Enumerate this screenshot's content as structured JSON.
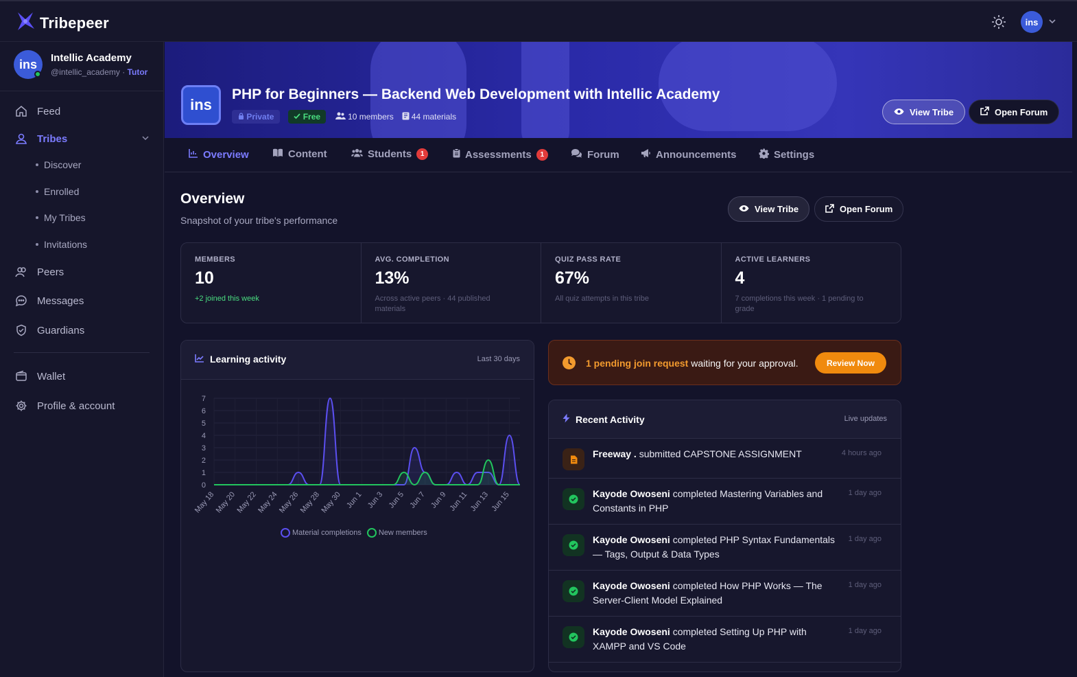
{
  "brand": {
    "name": "Tribepeer"
  },
  "profile": {
    "initials": "ins",
    "name": "Intellic Academy",
    "handle": "@intellic_academy",
    "separator": " · ",
    "role": "Tutor"
  },
  "nav": {
    "feed": "Feed",
    "tribes": "Tribes",
    "tribes_sub": [
      "Discover",
      "Enrolled",
      "My Tribes",
      "Invitations"
    ],
    "peers": "Peers",
    "messages": "Messages",
    "guardians": "Guardians",
    "wallet": "Wallet",
    "profile": "Profile & account"
  },
  "banner": {
    "logo_text": "ins",
    "title": "PHP for Beginners — Backend Web Development with Intellic Academy",
    "private": "Private",
    "free": "Free",
    "members": "10 members",
    "materials": "44 materials",
    "view_tribe": "View Tribe",
    "open_forum": "Open Forum"
  },
  "tabs": [
    {
      "label": "Overview"
    },
    {
      "label": "Content"
    },
    {
      "label": "Students",
      "badge": "1"
    },
    {
      "label": "Assessments",
      "badge": "1"
    },
    {
      "label": "Forum"
    },
    {
      "label": "Announcements"
    },
    {
      "label": "Settings"
    }
  ],
  "overview": {
    "title": "Overview",
    "subtitle": "Snapshot of your tribe's performance",
    "view_tribe": "View Tribe",
    "open_forum": "Open Forum"
  },
  "stats": [
    {
      "label": "MEMBERS",
      "value": "10",
      "note": "+2 joined this week"
    },
    {
      "label": "AVG. COMPLETION",
      "value": "13%",
      "note": "Across active peers · 44 published materials"
    },
    {
      "label": "QUIZ PASS RATE",
      "value": "67%",
      "note": "All quiz attempts in this tribe"
    },
    {
      "label": "ACTIVE LEARNERS",
      "value": "4",
      "note": "7 completions this week · 1 pending to grade"
    }
  ],
  "chart_card": {
    "title": "Learning activity",
    "range": "Last 30 days"
  },
  "chart_data": {
    "type": "area",
    "x": [
      "May 18",
      "May 19",
      "May 20",
      "May 21",
      "May 22",
      "May 23",
      "May 24",
      "May 25",
      "May 26",
      "May 27",
      "May 28",
      "May 29",
      "May 30",
      "May 31",
      "Jun 1",
      "Jun 2",
      "Jun 3",
      "Jun 4",
      "Jun 5",
      "Jun 6",
      "Jun 7",
      "Jun 8",
      "Jun 9",
      "Jun 10",
      "Jun 11",
      "Jun 12",
      "Jun 13",
      "Jun 14",
      "Jun 15",
      "Jun 16"
    ],
    "tick_labels": [
      "May 18",
      "May 20",
      "May 22",
      "May 24",
      "May 26",
      "May 28",
      "May 30",
      "Jun 1",
      "Jun 3",
      "Jun 5",
      "Jun 7",
      "Jun 9",
      "Jun 11",
      "Jun 13",
      "Jun 15"
    ],
    "series": [
      {
        "name": "Material completions",
        "color": "#5b4ff0",
        "values": [
          0,
          0,
          0,
          0,
          0,
          0,
          0,
          0,
          1,
          0,
          0,
          7,
          0,
          0,
          0,
          0,
          0,
          0,
          0,
          3,
          1,
          0,
          0,
          1,
          0,
          1,
          1,
          0,
          4,
          0
        ]
      },
      {
        "name": "New members",
        "color": "#22c55e",
        "values": [
          0,
          0,
          0,
          0,
          0,
          0,
          0,
          0,
          0,
          0,
          0,
          0,
          0,
          0,
          0,
          0,
          0,
          0,
          1,
          0,
          1,
          0,
          0,
          0,
          0,
          0,
          2,
          0,
          0,
          0
        ]
      }
    ],
    "ylim": [
      0,
      7
    ],
    "yticks": [
      0,
      1,
      2,
      3,
      4,
      5,
      6,
      7
    ],
    "grid": true,
    "legend": "bottom"
  },
  "pending": {
    "highlight": "1 pending join request",
    "rest": " waiting for your approval.",
    "button": "Review Now"
  },
  "activity": {
    "title": "Recent Activity",
    "live": "Live updates",
    "items": [
      {
        "icon": "doc",
        "actor": "Freeway .",
        "text": " submitted CAPSTONE ASSIGNMENT",
        "time": "4 hours ago"
      },
      {
        "icon": "check",
        "actor": "Kayode Owoseni",
        "text": " completed Mastering Variables and Constants in PHP",
        "time": "1 day ago"
      },
      {
        "icon": "check",
        "actor": "Kayode Owoseni",
        "text": " completed PHP Syntax Fundamentals — Tags, Output & Data Types",
        "time": "1 day ago"
      },
      {
        "icon": "check",
        "actor": "Kayode Owoseni",
        "text": " completed How PHP Works — The Server-Client Model Explained",
        "time": "1 day ago"
      },
      {
        "icon": "check",
        "actor": "Kayode Owoseni",
        "text": " completed Setting Up PHP with XAMPP and VS Code",
        "time": "1 day ago"
      }
    ]
  }
}
